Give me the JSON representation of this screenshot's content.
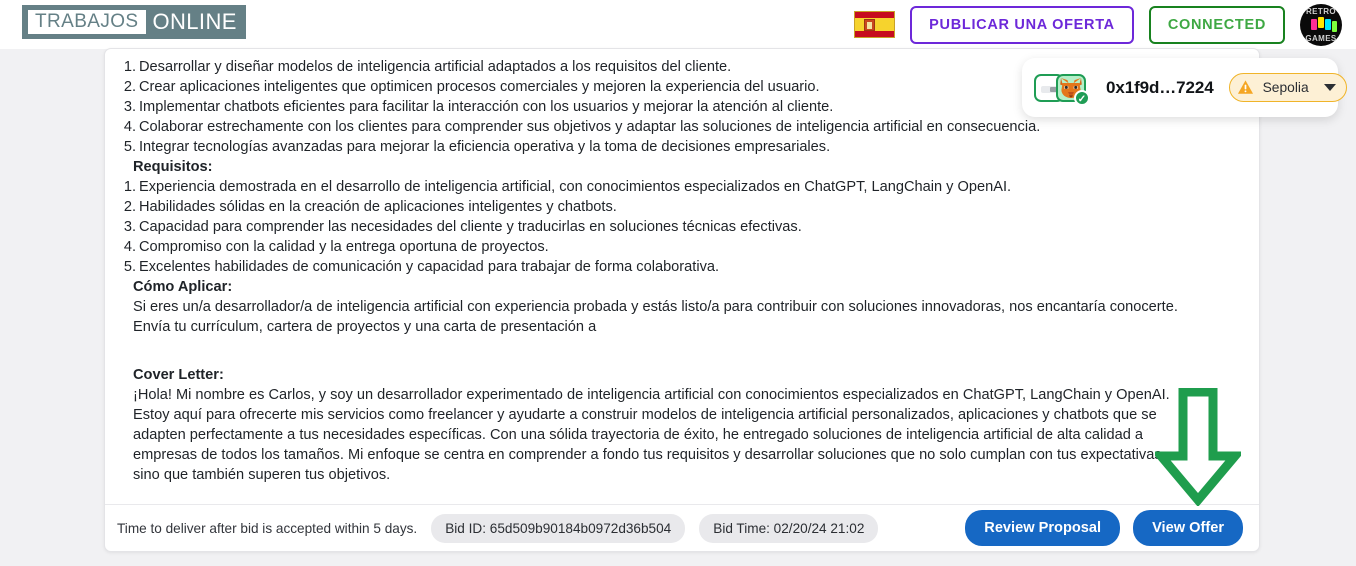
{
  "header": {
    "logo_left": "TRABAJOS",
    "logo_right": "ONLINE",
    "flag_icon": "spain-flag-icon",
    "publish_button": "PUBLICAR UNA OFERTA",
    "connected_button": "CONNECTED",
    "avatar": {
      "top_text": "RETRO",
      "bottom_text": "GAMES"
    }
  },
  "wallet": {
    "address": "0x1f9d…7224",
    "network": "Sepolia",
    "wallet_icon": "metamask-fox-icon",
    "connected_badge_icon": "check-circle-icon",
    "warning_icon": "warning-triangle-icon",
    "dropdown_icon": "chevron-down-icon"
  },
  "job": {
    "responsibilities": [
      {
        "num": "1.",
        "text": "Desarrollar y diseñar modelos de inteligencia artificial adaptados a los requisitos del cliente."
      },
      {
        "num": "2.",
        "text": "Crear aplicaciones inteligentes que optimicen procesos comerciales y mejoren la experiencia del usuario."
      },
      {
        "num": "3.",
        "text": "Implementar chatbots eficientes para facilitar la interacción con los usuarios y mejorar la atención al cliente."
      },
      {
        "num": "4.",
        "text": "Colaborar estrechamente con los clientes para comprender sus objetivos y adaptar las soluciones de inteligencia artificial en consecuencia."
      },
      {
        "num": "5.",
        "text": "Integrar tecnologías avanzadas para mejorar la eficiencia operativa y la toma de decisiones empresariales."
      }
    ],
    "requirements_heading": "Requisitos:",
    "requirements": [
      {
        "num": "1.",
        "text": "Experiencia demostrada en el desarrollo de inteligencia artificial, con conocimientos especializados en ChatGPT, LangChain y OpenAI."
      },
      {
        "num": "2.",
        "text": "Habilidades sólidas en la creación de aplicaciones inteligentes y chatbots."
      },
      {
        "num": "3.",
        "text": "Capacidad para comprender las necesidades del cliente y traducirlas en soluciones técnicas efectivas."
      },
      {
        "num": "4.",
        "text": "Compromiso con la calidad y la entrega oportuna de proyectos."
      },
      {
        "num": "5.",
        "text": "Excelentes habilidades de comunicación y capacidad para trabajar de forma colaborativa."
      }
    ],
    "how_to_apply_heading": "Cómo Aplicar:",
    "how_to_apply_line1": "Si eres un/a desarrollador/a de inteligencia artificial con experiencia probada y estás listo/a para contribuir con soluciones innovadoras, nos encantaría conocerte.",
    "how_to_apply_line2": "Envía tu currículum, cartera de proyectos y una carta de presentación a",
    "cover_letter_heading": "Cover Letter:",
    "cover_letter_lines": [
      "¡Hola! Mi nombre es Carlos, y soy un desarrollador experimentado de inteligencia artificial con conocimientos especializados en ChatGPT, LangChain y OpenAI.",
      "Estoy aquí para ofrecerte mis servicios como freelancer y ayudarte a construir modelos de inteligencia artificial personalizados, aplicaciones y chatbots que se",
      "adapten perfectamente a tus necesidades específicas. Con una sólida trayectoria de éxito, he entregado soluciones de inteligencia artificial de alta calidad a",
      "empresas de todos los tamaños. Mi enfoque se centra en comprender a fondo tus requisitos y desarrollar soluciones que no solo cumplan con tus expectativas,",
      "sino que también superen tus objetivos."
    ]
  },
  "footer": {
    "delivery_text": "Time to deliver after bid is accepted within 5 days.",
    "bid_id": "Bid ID: 65d509b90184b0972d36b504",
    "bid_time": "Bid Time: 02/20/24 21:02",
    "review_proposal_button": "Review Proposal",
    "view_offer_button": "View Offer"
  },
  "annotation": {
    "arrow_icon": "green-down-arrow-icon",
    "color": "#1f9d4d"
  },
  "colors": {
    "brand_teal": "#658086",
    "purple": "#6d28d9",
    "green": "#3ea843",
    "blue_button": "#1668c4",
    "network_amber": "#f0b429"
  }
}
